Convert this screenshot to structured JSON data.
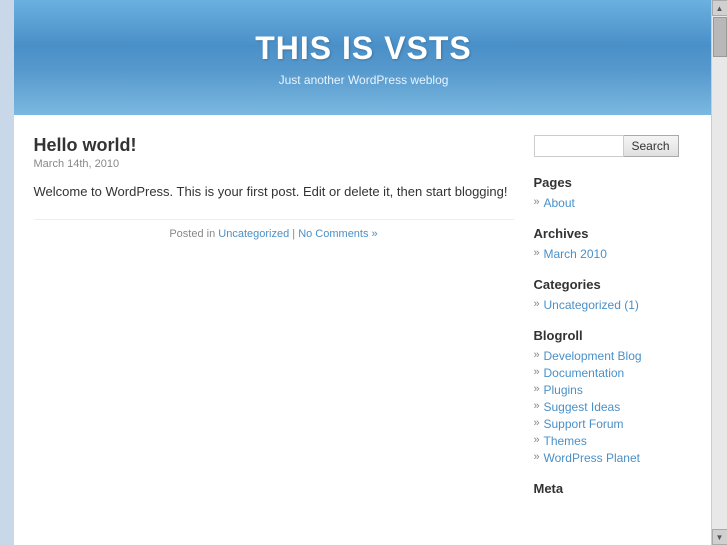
{
  "header": {
    "title": "THIS IS VSTS",
    "tagline": "Just another WordPress weblog"
  },
  "post": {
    "title": "Hello world!",
    "date": "March 14th, 2010",
    "content": "Welcome to WordPress. This is your first post. Edit or delete it, then start blogging!",
    "footer_prefix": "Posted in",
    "category_link": "Uncategorized",
    "separator": "|",
    "comments_link": "No Comments »"
  },
  "sidebar": {
    "search_placeholder": "",
    "search_button_label": "Search",
    "sections": [
      {
        "heading": "Pages",
        "items": [
          {
            "label": "About",
            "href": "#"
          }
        ]
      },
      {
        "heading": "Archives",
        "items": [
          {
            "label": "March 2010",
            "href": "#"
          }
        ]
      },
      {
        "heading": "Categories",
        "items": [
          {
            "label": "Uncategorized (1)",
            "href": "#"
          }
        ]
      },
      {
        "heading": "Blogroll",
        "items": [
          {
            "label": "Development Blog",
            "href": "#"
          },
          {
            "label": "Documentation",
            "href": "#"
          },
          {
            "label": "Plugins",
            "href": "#"
          },
          {
            "label": "Suggest Ideas",
            "href": "#"
          },
          {
            "label": "Support Forum",
            "href": "#"
          },
          {
            "label": "Themes",
            "href": "#"
          },
          {
            "label": "WordPress Planet",
            "href": "#"
          }
        ]
      },
      {
        "heading": "Meta",
        "items": []
      }
    ]
  }
}
